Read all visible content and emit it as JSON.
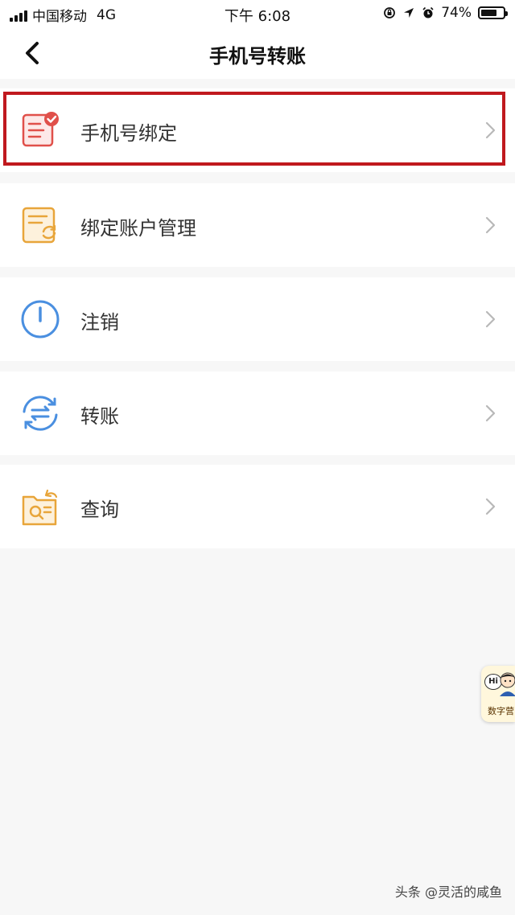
{
  "status_bar": {
    "carrier": "中国移动",
    "network": "4G",
    "time": "下午 6:08",
    "battery": "74%",
    "battery_level": 0.74,
    "icons": [
      "signal-icon",
      "orientation-lock-icon",
      "location-icon",
      "alarm-icon",
      "battery-icon"
    ]
  },
  "nav": {
    "back_icon": "chevron-left-icon",
    "title": "手机号转账"
  },
  "menu": [
    {
      "label": "手机号绑定",
      "icon": "phone-bind-icon",
      "icon_color": "#e0504a",
      "highlighted": true
    },
    {
      "label": "绑定账户管理",
      "icon": "account-manage-icon",
      "icon_color": "#e8a53a"
    },
    {
      "label": "注销",
      "icon": "power-icon",
      "icon_color": "#4a8fe0"
    },
    {
      "label": "转账",
      "icon": "transfer-icon",
      "icon_color": "#4a8fe0"
    },
    {
      "label": "查询",
      "icon": "query-icon",
      "icon_color": "#e8a53a"
    }
  ],
  "highlight_color": "#c0191e",
  "float_widget": {
    "greeting": "Hi",
    "label": "数字营"
  },
  "watermark": "头条 @灵活的咸鱼"
}
